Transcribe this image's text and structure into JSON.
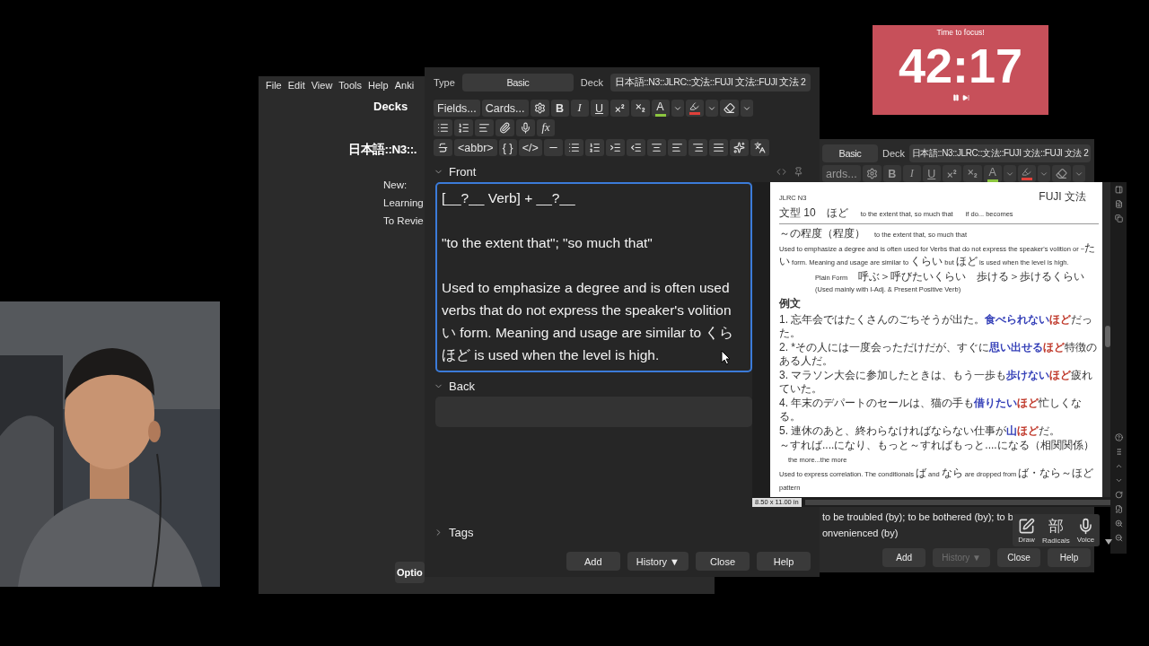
{
  "main_window": {
    "menu": [
      "File",
      "Edit",
      "View",
      "Tools",
      "Help",
      "Anki"
    ],
    "heading": "Decks",
    "deck_title": "日本語::N3::.",
    "stats": [
      "New:",
      "Learning",
      "To Revie"
    ],
    "options_button": "Optio"
  },
  "add_window": {
    "type_label": "Type",
    "note_type": "Basic",
    "deck_label": "Deck",
    "deck": "日本語::N3::JLRC::文法::FUJI 文法::FUJI 文法 2",
    "toolbar": [
      [
        {
          "kind": "text",
          "label": "Fields..."
        },
        {
          "kind": "text",
          "label": "Cards..."
        },
        {
          "kind": "icon"
        },
        {
          "kind": "bold",
          "label": "B"
        },
        {
          "kind": "italic",
          "label": "I"
        },
        {
          "kind": "underline",
          "label": "U"
        },
        {
          "kind": "icon"
        },
        {
          "kind": "icon"
        },
        {
          "kind": "color",
          "label": "A",
          "color": "#8cc63f"
        },
        {
          "kind": "caret"
        },
        {
          "kind": "highlight",
          "color": "#e0403a"
        },
        {
          "kind": "caret"
        },
        {
          "kind": "icon"
        },
        {
          "kind": "caret"
        }
      ],
      [
        {
          "kind": "icon"
        },
        {
          "kind": "icon"
        },
        {
          "kind": "icon"
        },
        {
          "kind": "icon"
        },
        {
          "kind": "icon"
        },
        {
          "kind": "formula",
          "label": "fx"
        }
      ],
      [
        {
          "kind": "icon"
        },
        {
          "kind": "text",
          "label": "<abbr>"
        },
        {
          "kind": "text",
          "label": "{ }"
        },
        {
          "kind": "text",
          "label": "</>"
        },
        {
          "kind": "icon"
        },
        {
          "kind": "icon"
        },
        {
          "kind": "icon"
        },
        {
          "kind": "icon"
        },
        {
          "kind": "icon"
        },
        {
          "kind": "icon"
        },
        {
          "kind": "icon"
        },
        {
          "kind": "icon"
        },
        {
          "kind": "icon"
        },
        {
          "kind": "icon"
        },
        {
          "kind": "icon"
        }
      ]
    ],
    "fields": [
      {
        "name": "Front",
        "expanded": true,
        "focused": true,
        "paragraphs": [
          [
            "[__?__ Verb] + __?__"
          ],
          [
            "\"to the extent that\"; \"so much that\""
          ],
          [
            "Used to emphasize a degree and is often used",
            "verbs that do not express the speaker's volition",
            "い form. Meaning and usage are similar to くら",
            "ほど is used when the level is high."
          ]
        ]
      },
      {
        "name": "Back",
        "expanded": true,
        "focused": false
      }
    ],
    "tags": {
      "label": "Tags",
      "expanded": false
    },
    "buttons": [
      {
        "label": "Add",
        "disabled": false
      },
      {
        "label": "History ▼",
        "disabled": false
      },
      {
        "label": "Close",
        "disabled": false
      },
      {
        "label": "Help",
        "disabled": false
      }
    ]
  },
  "second_window": {
    "note_type": "Basic",
    "deck_label": "Deck",
    "deck": "日本語::N3::JLRC::文法::FUJI 文法::FUJI 文法 2",
    "toolbar": [
      {
        "kind": "text",
        "label": "ards..."
      },
      {
        "kind": "icon"
      },
      {
        "kind": "bold",
        "label": "B"
      },
      {
        "kind": "italic",
        "label": "I"
      },
      {
        "kind": "underline",
        "label": "U"
      },
      {
        "kind": "icon"
      },
      {
        "kind": "icon"
      },
      {
        "kind": "color",
        "label": "A",
        "color": "#8cc63f"
      },
      {
        "kind": "caret"
      },
      {
        "kind": "highlight",
        "color": "#e0403a"
      },
      {
        "kind": "caret"
      },
      {
        "kind": "icon"
      },
      {
        "kind": "caret"
      }
    ],
    "field_lines": [
      "to be troubled (by); to be bothered (by); to b",
      "onvenienced (by)"
    ],
    "buttons": [
      {
        "label": "Add",
        "disabled": false
      },
      {
        "label": "History ▼",
        "disabled": true
      },
      {
        "label": "Close",
        "disabled": false
      },
      {
        "label": "Help",
        "disabled": false
      }
    ]
  },
  "ime_panel": {
    "tools": [
      {
        "label": "Draw"
      },
      {
        "label": "Radicals",
        "glyph": "部"
      },
      {
        "label": "Voice"
      }
    ]
  },
  "pdf_viewer": {
    "page_size": "8.50 x 11.00 in",
    "lines": [
      {
        "kind": "meta",
        "segments": [
          {
            "text": "JLRC N3",
            "kind": "en"
          },
          {
            "text": "FUJI 文法",
            "kind": "ja"
          }
        ]
      },
      {
        "kind": "title",
        "segments": [
          {
            "text": "文型 10　ほど",
            "kind": "ja"
          },
          {
            "text": "to the extent that, so much that",
            "kind": "en"
          },
          {
            "text": "if do... becomes",
            "kind": "en"
          }
        ]
      },
      {
        "kind": "heading",
        "segments": [
          {
            "text": "～の程度（程度）",
            "kind": "ja"
          },
          {
            "text": "to the extent that, so much that",
            "kind": "en"
          }
        ]
      },
      {
        "kind": "body",
        "segments": [
          {
            "text": "Used to emphasize a degree and is often used for Verbs that do not express the speaker's volition or ~",
            "kind": "en"
          },
          {
            "text": "たい",
            "kind": "ja"
          },
          {
            "text": " form. Meaning and usage are similar to ",
            "kind": "en"
          },
          {
            "text": "くらい",
            "kind": "ja"
          },
          {
            "text": " but ",
            "kind": "en"
          },
          {
            "text": "ほど",
            "kind": "ja"
          },
          {
            "text": " is used when the level is high.",
            "kind": "en"
          }
        ]
      },
      {
        "kind": "indent",
        "segments": [
          {
            "text": "Plain Form",
            "kind": "en"
          },
          {
            "text": "呼ぶ＞呼びたいくらい",
            "kind": "ja"
          },
          {
            "text": "歩ける＞歩けるくらい",
            "kind": "ja"
          }
        ]
      },
      {
        "kind": "indent",
        "segments": [
          {
            "text": "(Used mainly with I-Adj. & Present Positive Verb)",
            "kind": "en"
          }
        ]
      },
      {
        "kind": "section",
        "segments": [
          {
            "text": "例文",
            "kind": "ja"
          }
        ]
      },
      {
        "kind": "example",
        "segments": [
          {
            "text": "1. 忘年会ではたくさんのごちそうが出た。",
            "kind": "ja"
          },
          {
            "text": "食べられない",
            "kind": "ja",
            "color": "#3540b8"
          },
          {
            "text": "ほど",
            "kind": "ja",
            "color": "#c0392b"
          },
          {
            "text": "だった。",
            "kind": "ja"
          }
        ]
      },
      {
        "kind": "example",
        "segments": [
          {
            "text": "2. *その人には一度会っただけだが、すぐに",
            "kind": "ja"
          },
          {
            "text": "思い出せる",
            "kind": "ja",
            "color": "#3540b8"
          },
          {
            "text": "ほど",
            "kind": "ja",
            "color": "#c0392b"
          },
          {
            "text": "特徴のある人だ。",
            "kind": "ja"
          }
        ]
      },
      {
        "kind": "example",
        "segments": [
          {
            "text": "3. マラソン大会に参加したときは、もう一歩も",
            "kind": "ja"
          },
          {
            "text": "歩けない",
            "kind": "ja",
            "color": "#3540b8"
          },
          {
            "text": "ほど",
            "kind": "ja",
            "color": "#c0392b"
          },
          {
            "text": "疲れていた。",
            "kind": "ja"
          }
        ]
      },
      {
        "kind": "example",
        "segments": [
          {
            "text": "4. 年末のデパートのセールは、猫の手も",
            "kind": "ja"
          },
          {
            "text": "借りたい",
            "kind": "ja",
            "color": "#3540b8"
          },
          {
            "text": "ほど",
            "kind": "ja",
            "color": "#c0392b"
          },
          {
            "text": "忙しくなる。",
            "kind": "ja"
          }
        ]
      },
      {
        "kind": "example",
        "segments": [
          {
            "text": "5. 連休のあと、終わらなければならない仕事が",
            "kind": "ja"
          },
          {
            "text": "山",
            "kind": "ja",
            "color": "#3540b8"
          },
          {
            "text": "ほど",
            "kind": "ja",
            "color": "#c0392b"
          },
          {
            "text": "だ。",
            "kind": "ja"
          }
        ]
      },
      {
        "kind": "heading",
        "segments": [
          {
            "text": "～すれば....になり、もっと～すればもっと....になる（相関関係）",
            "kind": "ja"
          },
          {
            "text": "the more...the more",
            "kind": "en"
          }
        ]
      },
      {
        "kind": "body",
        "segments": [
          {
            "text": "Used to express correlation. The conditionals ",
            "kind": "en"
          },
          {
            "text": "ば",
            "kind": "ja"
          },
          {
            "text": " and ",
            "kind": "en"
          },
          {
            "text": "なら",
            "kind": "ja"
          },
          {
            "text": " are dropped from ",
            "kind": "en"
          },
          {
            "text": "ば・なら～ほど",
            "kind": "ja"
          },
          {
            "text": " pattern",
            "kind": "en"
          }
        ]
      }
    ]
  },
  "timer": {
    "caption": "Time to focus!",
    "time": "42:17"
  }
}
